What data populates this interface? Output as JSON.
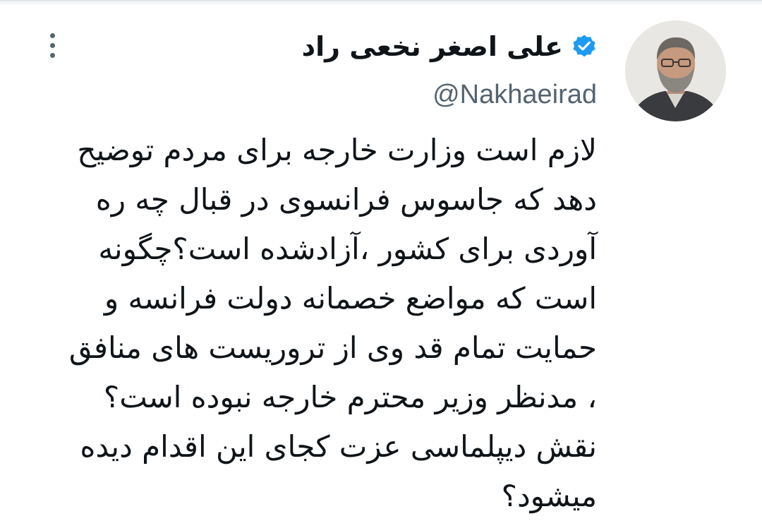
{
  "tweet": {
    "author": {
      "display_name": "علی اصغر نخعی راد",
      "handle": "@Nakhaeirad",
      "verified": true,
      "avatar_icon": "profile-photo",
      "badge_icon": "verified-checkmark-icon",
      "badge_color": "#1d9bf0"
    },
    "more_icon": "more-vertical-icon",
    "text_lines": [
      "لازم است وزارت خارجه برای مردم توضیح",
      "دهد که جاسوس فرانسوی در قبال چه ره",
      "آوردی برای کشور ،آزادشده است؟چگونه",
      "است که مواضع خصمانه دولت فرانسه و",
      "حمایت تمام قد وی از تروریست های منافق",
      "، مدنظر وزیر محترم خارجه نبوده است؟",
      "نقش دیپلماسی عزت کجای این اقدام دیده",
      "میشود؟"
    ]
  },
  "colors": {
    "text_primary": "#0f1419",
    "text_secondary": "#536471",
    "background": "#ffffff"
  }
}
